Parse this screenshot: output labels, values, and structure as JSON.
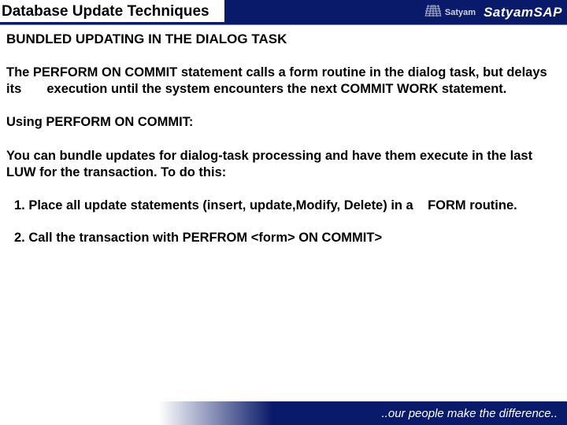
{
  "header": {
    "title": "Database Update Techniques",
    "logo1_text": "Satyam",
    "logo2_text": "SatyamSAP"
  },
  "content": {
    "subheading": "BUNDLED UPDATING IN THE DIALOG TASK",
    "para1": "The PERFORM ON COMMIT statement calls a form routine in the dialog task, but delays its       execution until the system encounters the next COMMIT WORK statement.",
    "para2": "Using PERFORM ON COMMIT:",
    "para3": "You can bundle  updates for dialog-task processing and have  them execute in the last LUW for the transaction. To do this:",
    "item1": "1. Place all update statements (insert, update,Modify, Delete) in a    FORM  routine.",
    "item2": "2. Call the  transaction with PERFROM <form> ON COMMIT>"
  },
  "footer": {
    "tagline": "..our people make the difference.."
  }
}
